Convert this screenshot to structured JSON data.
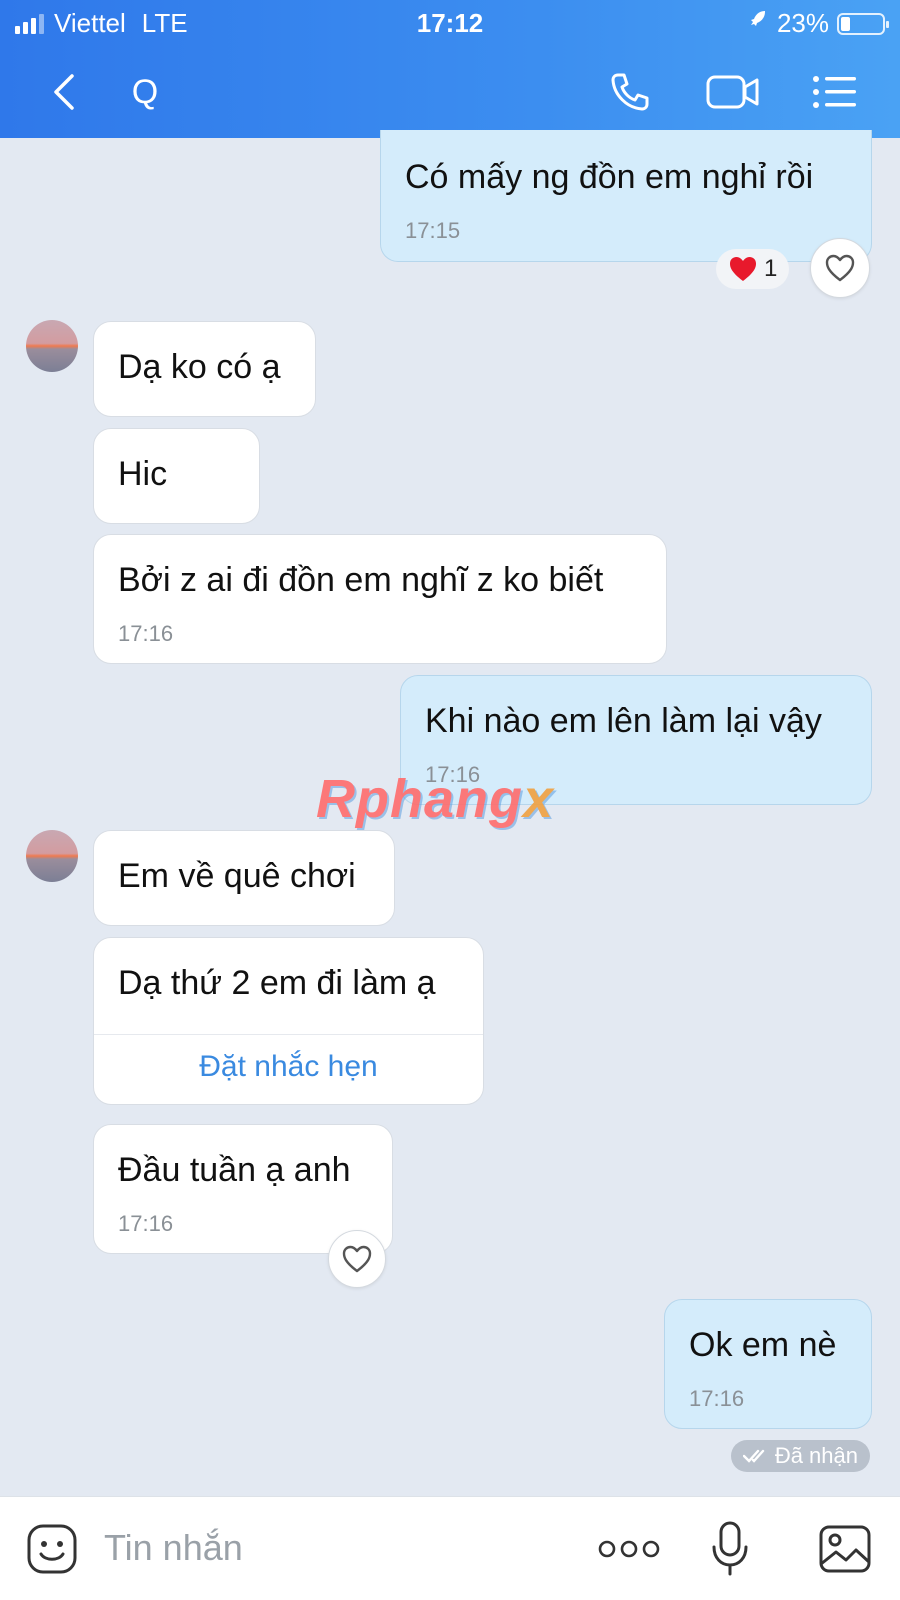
{
  "status_bar": {
    "carrier": "Viettel",
    "network": "LTE",
    "time": "17:12",
    "battery": "23%",
    "battery_level": 0.23
  },
  "header": {
    "title": "Q"
  },
  "messages": [
    {
      "dir": "out",
      "text": "Có mấy ng đồn em nghỉ rồi",
      "time": "17:15",
      "reaction_count": "1"
    },
    {
      "dir": "in",
      "text": "Dạ ko có ạ"
    },
    {
      "dir": "in",
      "text": "Hic"
    },
    {
      "dir": "in",
      "text": "Bởi z ai đi đồn em nghĩ z ko biết",
      "time": "17:16"
    },
    {
      "dir": "out",
      "text": "Khi nào em lên làm lại vậy",
      "time": "17:16"
    },
    {
      "dir": "in",
      "text": "Em về quê chơi"
    },
    {
      "dir": "in",
      "text": "Dạ thứ 2 em đi làm ạ",
      "action": "Đặt nhắc hẹn"
    },
    {
      "dir": "in",
      "text": "Đầu tuần ạ anh",
      "time": "17:16"
    },
    {
      "dir": "out",
      "text": "Ok em nè",
      "time": "17:16"
    }
  ],
  "receipt": "Đã nhận",
  "watermark": "Rphangx",
  "input": {
    "placeholder": "Tin nhắn"
  },
  "colors": {
    "header_start": "#2f78ea",
    "header_end": "#4aa2f4",
    "outgoing_bubble": "#d4ecfb",
    "incoming_bubble": "#ffffff",
    "chat_background": "#e3e9f2",
    "link": "#3a8ae0"
  },
  "icons": [
    "back-icon",
    "phone-icon",
    "video-icon",
    "menu-icon",
    "heart-icon",
    "emoji-icon",
    "more-icon",
    "mic-icon",
    "image-icon",
    "double-check-icon",
    "rocket-icon"
  ]
}
